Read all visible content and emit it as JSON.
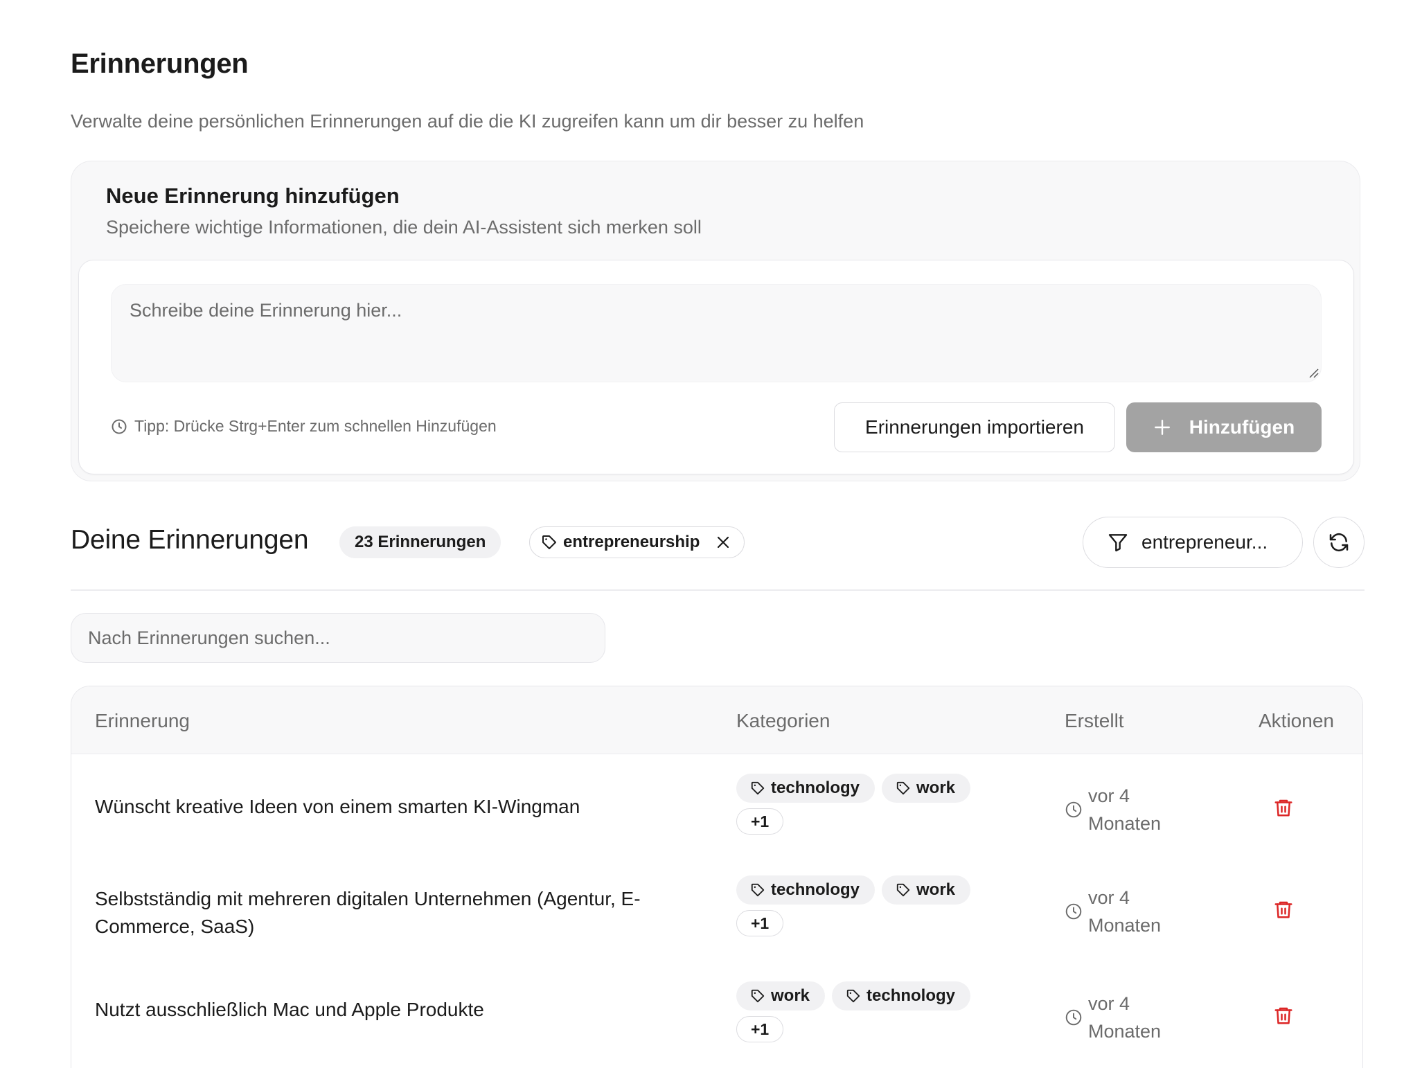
{
  "page": {
    "title": "Erinnerungen",
    "subtitle": "Verwalte deine persönlichen Erinnerungen auf die die KI zugreifen kann um dir besser zu helfen"
  },
  "add_card": {
    "title": "Neue Erinnerung hinzufügen",
    "description": "Speichere wichtige Informationen, die dein AI-Assistent sich merken soll",
    "textarea_value": "",
    "textarea_placeholder": "Schreibe deine Erinnerung hier...",
    "tip": "Tipp: Drücke Strg+Enter zum schnellen Hinzufügen",
    "import_label": "Erinnerungen importieren",
    "add_label": "Hinzufügen"
  },
  "memories_section": {
    "title": "Deine Erinnerungen",
    "count": "23 Erinnerungen",
    "active_filter": "entrepreneurship",
    "filter_select_value": "entrepreneur...",
    "search_value": "",
    "search_placeholder": "Nach Erinnerungen suchen..."
  },
  "table": {
    "headers": {
      "memory": "Erinnerung",
      "categories": "Kategorien",
      "created": "Erstellt",
      "actions": "Aktionen"
    },
    "rows": [
      {
        "text": "Wünscht kreative Ideen von einem smarten KI-Wingman",
        "tags": [
          "technology",
          "work"
        ],
        "more": "+1",
        "created": "vor 4 Monaten"
      },
      {
        "text": "Selbstständig mit mehreren digitalen Unternehmen (Agentur, E-Commerce, SaaS)",
        "tags": [
          "technology",
          "work"
        ],
        "more": "+1",
        "created": "vor 4 Monaten"
      },
      {
        "text": "Nutzt ausschließlich Mac und Apple Produkte",
        "tags": [
          "work",
          "technology"
        ],
        "more": "+1",
        "created": "vor 4 Monaten"
      }
    ]
  },
  "colors": {
    "delete": "#dc2626",
    "add_button_disabled": "#a3a3a3",
    "muted_text": "#6b6b6b"
  },
  "icons": {
    "tip": "clock-icon",
    "add": "plus-icon",
    "tag": "tag-icon",
    "remove_filter": "close-icon",
    "filter": "funnel-icon",
    "refresh": "refresh-icon",
    "created": "clock-icon",
    "delete": "trash-icon"
  }
}
